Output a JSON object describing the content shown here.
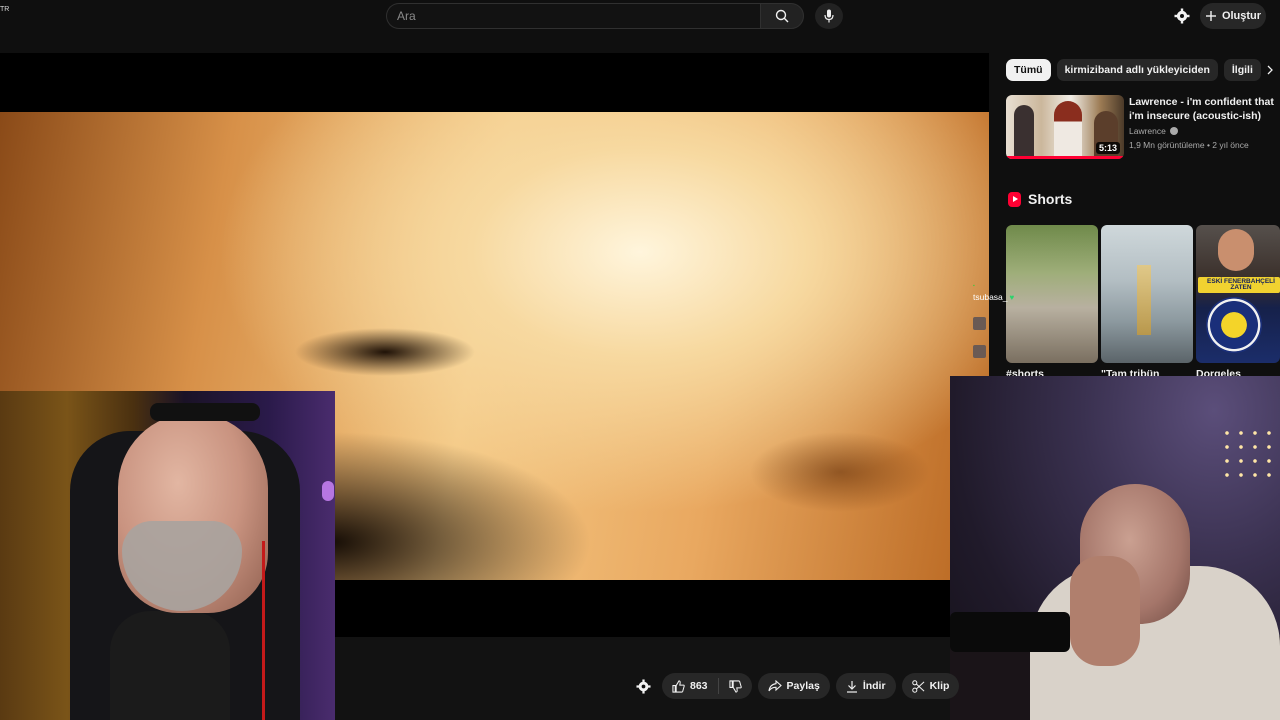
{
  "topbar": {
    "locale": "TR",
    "search_placeholder": "Ara",
    "create_label": "Oluştur"
  },
  "chips": [
    {
      "label": "Tümü",
      "active": true
    },
    {
      "label": "kirmiziband adlı yükleyiciden",
      "active": false
    },
    {
      "label": "İlgili",
      "active": false
    }
  ],
  "recommendation": {
    "title": "Lawrence - i'm confident that i'm insecure (acoustic-ish)",
    "channel": "Lawrence",
    "meta": "1,9 Mn görüntüleme • 2 yıl önce",
    "duration": "5:13"
  },
  "shorts": {
    "heading": "Shorts",
    "items": [
      {
        "title": "#shorts"
      },
      {
        "title": "\"Tam tribün"
      },
      {
        "title": "Dorgeles",
        "badge": "ESKİ FENERBAHÇELİ ZATEN"
      }
    ]
  },
  "chat": {
    "messages": [
      {
        "name": "tsubasa_"
      }
    ]
  },
  "actions": {
    "likes": "863",
    "share_label": "Paylaş",
    "download_label": "İndir",
    "clip_label": "Klip"
  },
  "icons": {
    "search": "search-icon",
    "mic": "mic-icon",
    "settings": "gear-icon",
    "create": "plus-icon",
    "like": "thumbs-up-icon",
    "dislike": "thumbs-down-icon",
    "share": "share-icon",
    "download": "download-icon",
    "clip": "scissors-icon"
  },
  "colors": {
    "background": "#0f0f0f",
    "accent": "#ff0033",
    "chip_bg": "#272727"
  }
}
